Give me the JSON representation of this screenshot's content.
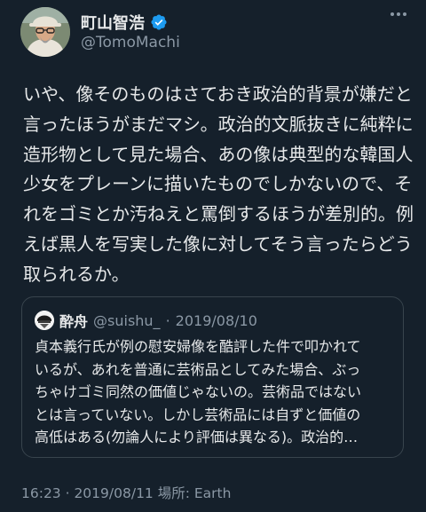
{
  "author": {
    "display_name": "町山智浩",
    "handle": "@TomoMachi",
    "avatar_icon": "user-avatar",
    "verified_icon": "verified-badge-icon"
  },
  "more_icon": "more-options-icon",
  "tweet": {
    "lines": [
      "いや、像そのものはさておき政治的背景が嫌だと",
      "言ったほうがまだマシ。政治的文脈抜きに純粋に",
      "造形物として見た場合、あの像は典型的な韓国人",
      "少女をプレーンに描いたものでしかないので、そ",
      "れをゴミとか汚ねえと罵倒するほうが差別的。例",
      "えば黒人を写実した像に対してそう言ったらどう",
      "取られるか。"
    ]
  },
  "quote": {
    "display_name": "酔舟",
    "handle": "@suishu_",
    "separator": "·",
    "date": "2019/08/10",
    "lines": [
      "貞本義行氏が例の慰安婦像を酷評した件で叩かれて",
      "いるが、あれを普通に芸術品としてみた場合、ぶっ",
      "ちゃけゴミ同然の価値じゃないの。芸術品ではない",
      "とは言っていない。しかし芸術品には自ずと価値の",
      "高低はある(勿論人により評価は異なる)。政治的…"
    ]
  },
  "meta": "16:23 · 2019/08/11 場所: Earth",
  "colors": {
    "background": "#15202b",
    "text": "#e7e9ea",
    "secondary": "#8b98a5",
    "verified": "#1d9bf0",
    "border": "#38444d"
  }
}
